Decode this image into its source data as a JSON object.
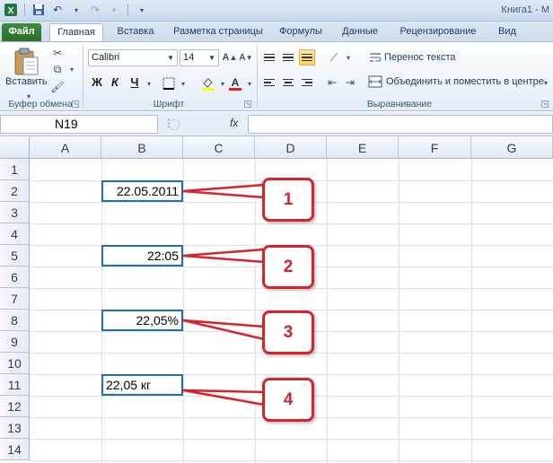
{
  "window": {
    "title": "Книга1 - M"
  },
  "tabs": [
    {
      "label": "Файл",
      "kind": "file"
    },
    {
      "label": "Главная",
      "kind": "active"
    },
    {
      "label": "Вставка"
    },
    {
      "label": "Разметка страницы"
    },
    {
      "label": "Формулы"
    },
    {
      "label": "Данные"
    },
    {
      "label": "Рецензирование"
    },
    {
      "label": "Вид"
    }
  ],
  "ribbon": {
    "clipboard": {
      "paste_label": "Вставить",
      "group_label": "Буфер обмена"
    },
    "font": {
      "name": "Calibri",
      "size": "14",
      "bold": "Ж",
      "italic": "К",
      "underline": "Ч",
      "group_label": "Шрифт"
    },
    "alignment": {
      "wrap_text": "Перенос текста",
      "merge_center": "Объединить и поместить в центре",
      "group_label": "Выравнивание"
    }
  },
  "formula_bar": {
    "name_box": "N19",
    "fx": "fx",
    "value": ""
  },
  "grid": {
    "columns": [
      "A",
      "B",
      "C",
      "D",
      "E",
      "F",
      "G"
    ],
    "rows": [
      "1",
      "2",
      "3",
      "4",
      "5",
      "6",
      "7",
      "8",
      "9",
      "10",
      "11",
      "12",
      "13",
      "14"
    ]
  },
  "cells": {
    "b2": "22.05.2011",
    "b5": "22:05",
    "b8": "22,05%",
    "b11": "22,05 кг"
  },
  "callouts": [
    "1",
    "2",
    "3",
    "4"
  ],
  "colors": {
    "accent_red": "#d9232b",
    "cell_border": "#1f6db7",
    "file_tab": "#2b6f2b"
  }
}
